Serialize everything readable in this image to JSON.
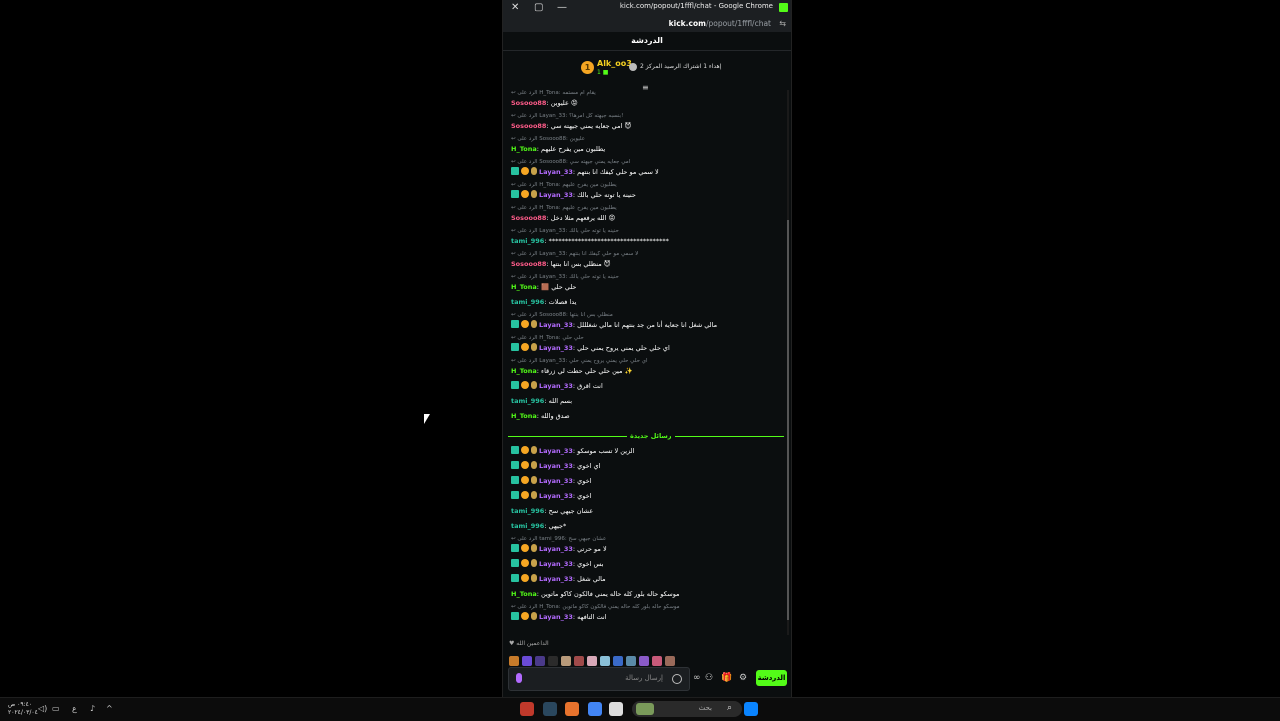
{
  "window": {
    "title": "kick.com/popout/1fffl/chat - Google Chrome",
    "url_host": "kick.com",
    "url_path": "/popout/1fffl/chat",
    "controls": {
      "close": "✕",
      "restore": "▢",
      "minimize": "—"
    }
  },
  "chat": {
    "header_title": "الدردشة",
    "pinned": {
      "user": "Alk_oo3",
      "rank": "1",
      "text": "إهداء 1 اشتراك الرصيد المركز 2",
      "sub": "1 ■"
    },
    "new_messages_label": "رسائل جديدة",
    "messages": [
      {
        "reply": "الرد على H_Tona: يقام ام مستمه",
        "user": "Sosooo88",
        "color": "#ff5c8a",
        "badges": [],
        "text": "عليوين 😡"
      },
      {
        "reply": "الرد على Layan_33: بنسبه جيهته كل امرها؟!",
        "user": "Sosooo88",
        "color": "#ff5c8a",
        "badges": [],
        "text": "امي جعايه يمني جيهته سي 😈"
      },
      {
        "reply": "الرد على Sosooo88: عليوين",
        "user": "H_Tona",
        "color": "#53fc18",
        "badges": [],
        "text": "يطلبون مين يفرح عليهم"
      },
      {
        "reply": "الرد على Sosooo88: امي جعايه يمني جيهته سي",
        "user": "Layan_33",
        "color": "#b36bff",
        "badges": [
          "sub",
          "gold",
          "hand"
        ],
        "text": "لا سمي مو حلي كيفك انا بنتهم"
      },
      {
        "reply": "الرد على H_Tona: يطلبون مين يفرح عليهم",
        "user": "Layan_33",
        "color": "#b36bff",
        "badges": [
          "sub",
          "gold",
          "hand"
        ],
        "text": "حنينه يا توته حلي بالك"
      },
      {
        "reply": "الرد على H_Tona: يطلبون مين يفرح عليهم",
        "user": "Sosooo88",
        "color": "#ff5c8a",
        "badges": [],
        "text": "الله يرفعهم مثلا دخل 😡"
      },
      {
        "reply": "الرد على Layan_33: حنينه يا توته حلي بالك",
        "user": "tami_996",
        "color": "#27c2a0",
        "badges": [],
        "text": "*************************************"
      },
      {
        "reply": "الرد على Layan_33: لا سمي مو حلي كيفك انا بنتهم",
        "user": "Sosooo88",
        "color": "#ff5c8a",
        "badges": [],
        "text": "منظلي بس انا بنتها 😈"
      },
      {
        "reply": "الرد على Layan_33: حنينه يا توته حلي بالك",
        "user": "H_Tona",
        "color": "#53fc18",
        "badges": [],
        "text": "🟫 حلي حلي"
      },
      {
        "reply": "",
        "user": "tami_996",
        "color": "#27c2a0",
        "badges": [],
        "text": "يدا فصلات"
      },
      {
        "reply": "الرد على Sosooo88: منظلي بس انا بنتها",
        "user": "Layan_33",
        "color": "#b36bff",
        "badges": [
          "sub",
          "gold",
          "hand"
        ],
        "text": "مالي شغل انا جعايه أنا من جد بنتهم انا مالي شغلللل"
      },
      {
        "reply": "الرد على H_Tona: حلي حلي",
        "user": "Layan_33",
        "color": "#b36bff",
        "badges": [
          "sub",
          "gold",
          "hand"
        ],
        "text": "اي حلي حلي يمني يروح يمني حلي"
      },
      {
        "reply": "الرد على Layan_33: اي حلي حلي يمني يروح يمني حلي",
        "user": "H_Tona",
        "color": "#53fc18",
        "badges": [],
        "text": "مين حلي حلي حطت لي زرقاء ✨"
      },
      {
        "reply": "",
        "user": "Layan_33",
        "color": "#b36bff",
        "badges": [
          "sub",
          "gold",
          "hand"
        ],
        "text": "انت اقرق"
      },
      {
        "reply": "",
        "user": "tami_996",
        "color": "#27c2a0",
        "badges": [],
        "text": "بسم الله"
      },
      {
        "reply": "",
        "user": "H_Tona",
        "color": "#53fc18",
        "badges": [],
        "text": "صدق والله"
      }
    ],
    "new_messages": [
      {
        "reply": "",
        "user": "Layan_33",
        "color": "#b36bff",
        "badges": [
          "sub",
          "gold",
          "hand"
        ],
        "text": "الزين لا تسب موسكو"
      },
      {
        "reply": "",
        "user": "Layan_33",
        "color": "#b36bff",
        "badges": [
          "sub",
          "gold",
          "hand"
        ],
        "text": "اي اخوي"
      },
      {
        "reply": "",
        "user": "Layan_33",
        "color": "#b36bff",
        "badges": [
          "sub",
          "gold",
          "hand"
        ],
        "text": "اخوي"
      },
      {
        "reply": "",
        "user": "Layan_33",
        "color": "#b36bff",
        "badges": [
          "sub",
          "gold",
          "hand"
        ],
        "text": "اخوي"
      },
      {
        "reply": "",
        "user": "tami_996",
        "color": "#27c2a0",
        "badges": [],
        "text": "عشان جيهي سح"
      },
      {
        "reply": "",
        "user": "tami_996",
        "color": "#27c2a0",
        "badges": [],
        "text": "جيهي*"
      },
      {
        "reply": "الرد على tami_996: عشان جيهي سح",
        "user": "Layan_33",
        "color": "#b36bff",
        "badges": [
          "sub",
          "gold",
          "hand"
        ],
        "text": "لا مو حرتي"
      },
      {
        "reply": "",
        "user": "Layan_33",
        "color": "#b36bff",
        "badges": [
          "sub",
          "gold",
          "hand"
        ],
        "text": "بس اخوي"
      },
      {
        "reply": "",
        "user": "Layan_33",
        "color": "#b36bff",
        "badges": [
          "sub",
          "gold",
          "hand"
        ],
        "text": "مالي شغل"
      },
      {
        "reply": "",
        "user": "H_Tona",
        "color": "#53fc18",
        "badges": [],
        "text": "موسكو حاله بلور كله حاله يمني فالكون كاكو ماتوين"
      },
      {
        "reply": "الرد على H_Tona: موسكو حاله بلور كله حاله يمني فالكون كاكو ماتوين",
        "user": "Layan_33",
        "color": "#b36bff",
        "badges": [
          "sub",
          "gold",
          "hand"
        ],
        "text": "انت التافهه"
      }
    ],
    "supporters_label": "♥ الداعمين الله",
    "supporter_colors": [
      "#c77b2a",
      "#6a4bd6",
      "#4a3a8a",
      "#2b2b2b",
      "#b89a7a",
      "#a04a4a",
      "#d8a8b8",
      "#8ac0d8",
      "#3a6ac8",
      "#5a8aa8",
      "#8a5ac8",
      "#c85a7a",
      "#9a6a5a"
    ],
    "composer": {
      "placeholder": "إرسال رسالة",
      "send_label": "الدردشة"
    },
    "tools": {
      "gear": "⚙",
      "gift": "🎁",
      "users": "⚇",
      "infinity": "∞"
    }
  },
  "taskbar": {
    "time": "٠٩:٤٠ ص",
    "date": "٢٠٢٤/٠٣/٠٤",
    "lang": "ع",
    "search_placeholder": "بحث"
  },
  "accent": "#53fc18"
}
